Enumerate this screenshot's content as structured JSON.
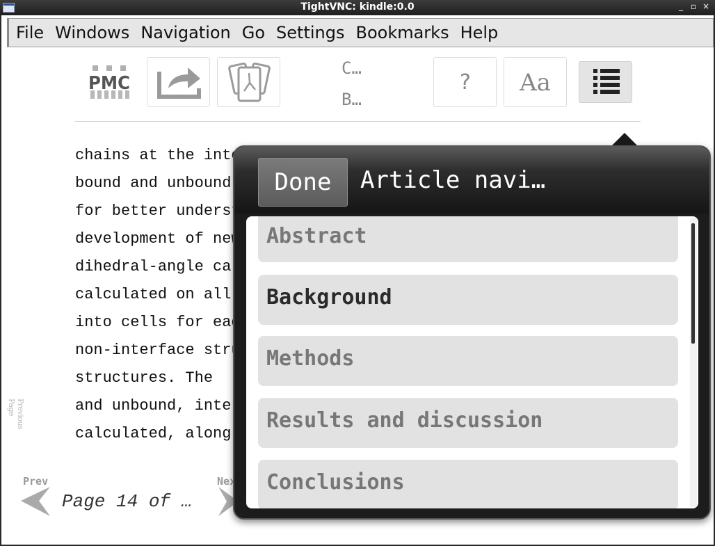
{
  "window": {
    "title": "TightVNC: kindle:0.0",
    "minimize": "_",
    "maximize": "▫",
    "close": "×"
  },
  "menubar": {
    "items": [
      "File",
      "Windows",
      "Navigation",
      "Go",
      "Settings",
      "Bookmarks",
      "Help"
    ]
  },
  "toolbar": {
    "logo_text": "PMC",
    "share_icon": "share-icon",
    "pdf_icon": "pdf-document-icon",
    "truncated_top": "C…",
    "truncated_bottom": "B…",
    "help_label": "?",
    "font_label": "Aa",
    "nav_icon": "list-icon"
  },
  "article": {
    "lines": [
      "chains at the interface",
      "bound and unbound",
      "for better understanding",
      "development of new",
      "dihedral-angle calculations",
      "calculated on all",
      "into cells for each",
      "non-interface structures",
      "structures. The",
      "and unbound, interface",
      "calculated, along"
    ],
    "side_label": "Previous Page"
  },
  "bottom_nav": {
    "prev_label": "Prev",
    "next_label": "Next",
    "page_indicator": "Page 14 of …"
  },
  "popover": {
    "done_label": "Done",
    "title": "Article navi…",
    "items": [
      {
        "label": "Abstract",
        "current": false
      },
      {
        "label": "Background",
        "current": true
      },
      {
        "label": "Methods",
        "current": false
      },
      {
        "label": "Results and discussion",
        "current": false
      },
      {
        "label": "Conclusions",
        "current": false
      }
    ]
  }
}
